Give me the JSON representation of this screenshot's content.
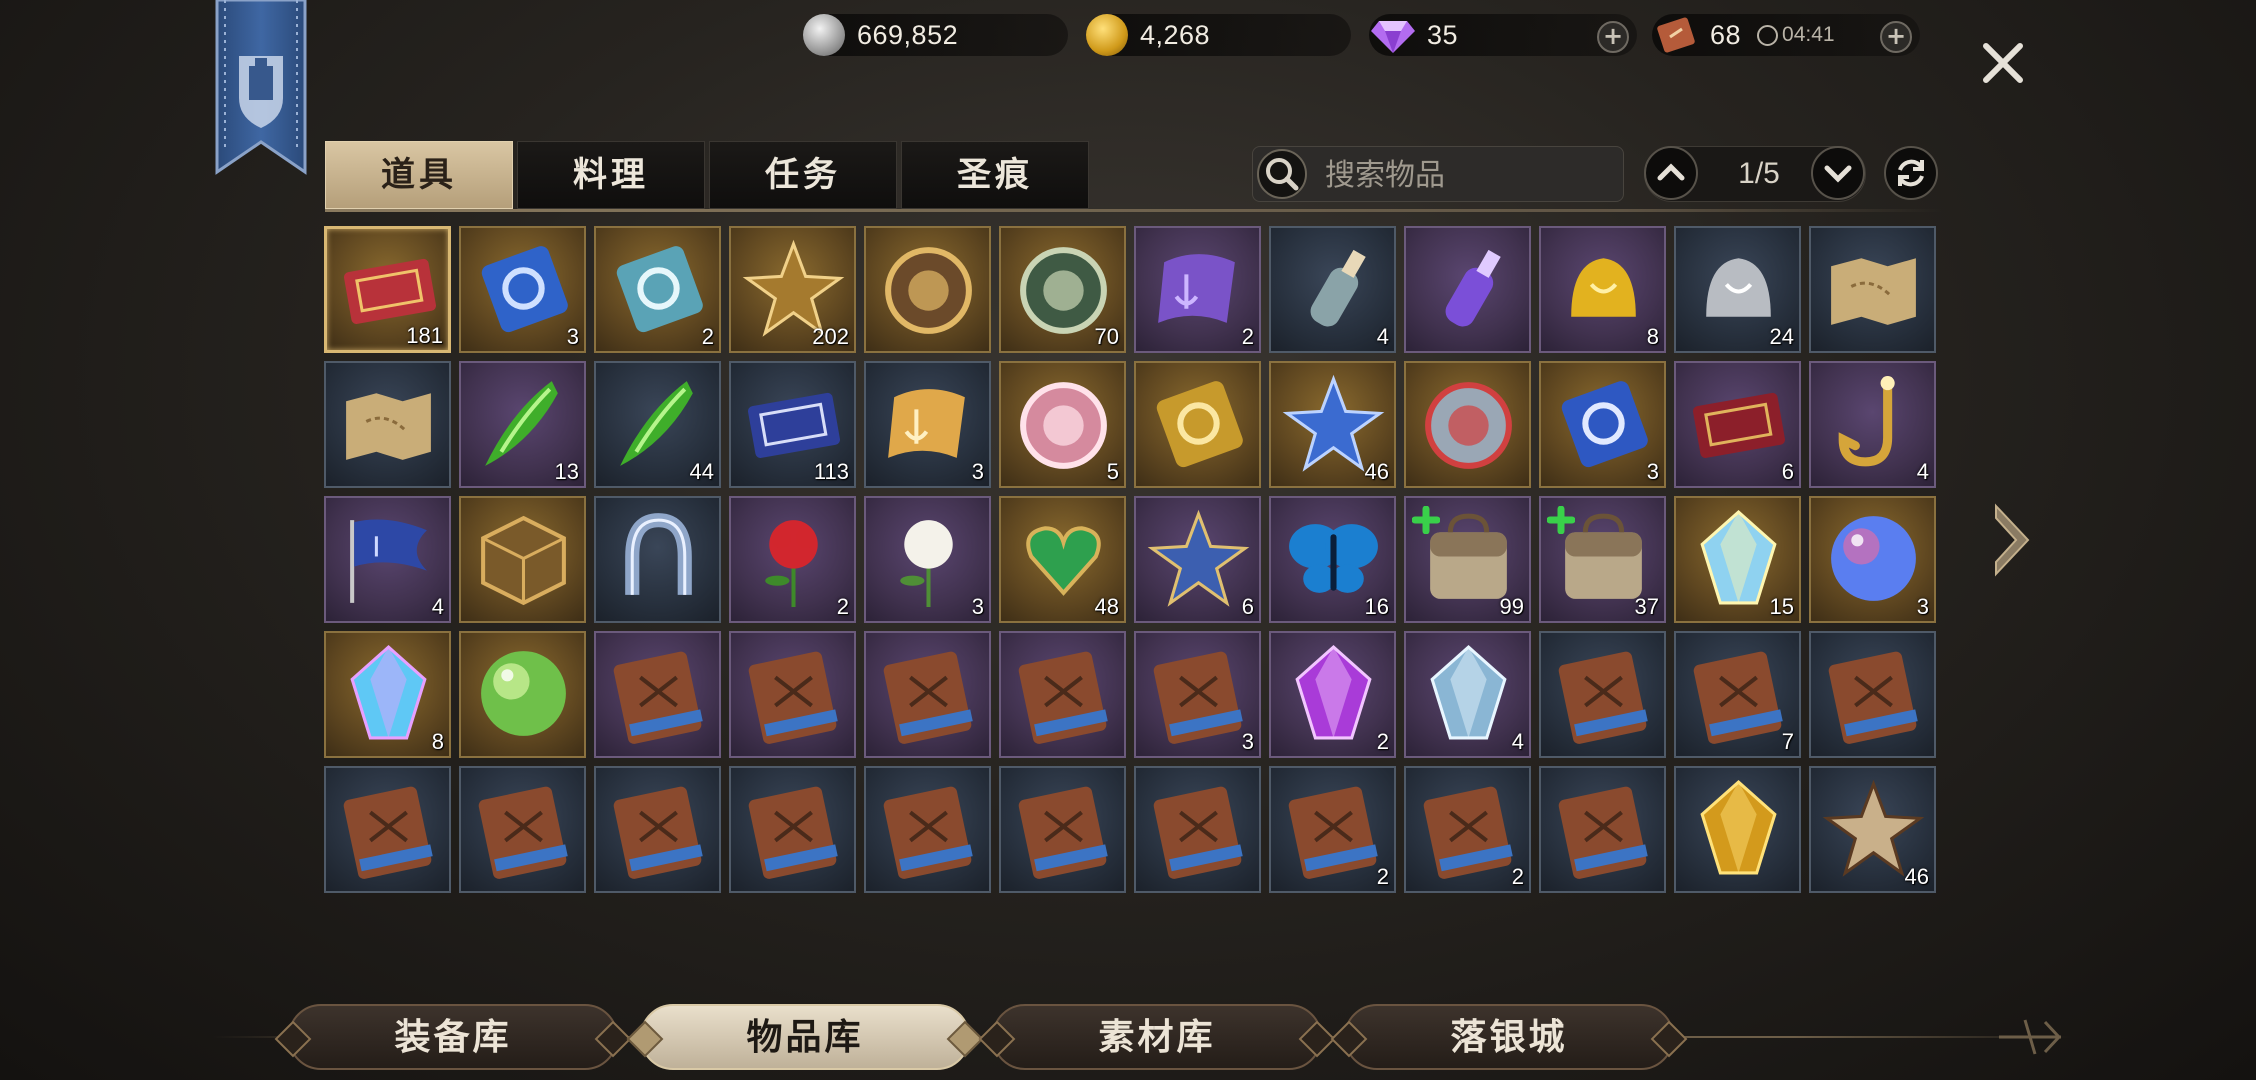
{
  "currencies": [
    {
      "icon": "silver-coin-icon",
      "value": "669,852"
    },
    {
      "icon": "gold-coin-icon",
      "value": "4,268"
    },
    {
      "icon": "diamond-icon",
      "value": "35"
    },
    {
      "icon": "stamina-ticket-icon",
      "value": "68",
      "timer": "04:41"
    }
  ],
  "tabs": [
    {
      "label": "道具",
      "active": true
    },
    {
      "label": "料理",
      "active": false
    },
    {
      "label": "任务",
      "active": false
    },
    {
      "label": "圣痕",
      "active": false
    }
  ],
  "search": {
    "placeholder": "搜索物品"
  },
  "pager": {
    "text": "1/5"
  },
  "items": [
    {
      "icon": "ticket-20-icon",
      "bg": "gold",
      "count": "181",
      "selected": true
    },
    {
      "icon": "blue-card-icon",
      "bg": "gold",
      "count": "3"
    },
    {
      "icon": "crystal-card-icon",
      "bg": "gold",
      "count": "2"
    },
    {
      "icon": "gilded-emblem-icon",
      "bg": "gold",
      "count": "202"
    },
    {
      "icon": "compass-emblem-icon",
      "bg": "gold",
      "count": ""
    },
    {
      "icon": "dragon-coin-icon",
      "bg": "gold",
      "count": "70"
    },
    {
      "icon": "anchor-scroll-icon",
      "bg": "purple",
      "count": "2"
    },
    {
      "icon": "message-bottle-icon",
      "bg": "blue",
      "count": "4"
    },
    {
      "icon": "potion-flask-icon",
      "bg": "purple",
      "count": ""
    },
    {
      "icon": "gold-bell-icon",
      "bg": "purple",
      "count": "8"
    },
    {
      "icon": "silver-bell-icon",
      "bg": "blue",
      "count": "24"
    },
    {
      "icon": "treasure-map-icon",
      "bg": "blue",
      "count": ""
    },
    {
      "icon": "old-map-icon",
      "bg": "blue",
      "count": ""
    },
    {
      "icon": "green-fang-icon",
      "bg": "purple",
      "count": "13"
    },
    {
      "icon": "green-fang-icon",
      "bg": "blue",
      "count": "44"
    },
    {
      "icon": "ticket-10-icon",
      "bg": "blue",
      "count": "113"
    },
    {
      "icon": "talisman-scroll-icon",
      "bg": "blue",
      "count": "3"
    },
    {
      "icon": "paw-coin-icon",
      "bg": "gold",
      "count": "5"
    },
    {
      "icon": "gold-ticket-icon",
      "bg": "gold",
      "count": ""
    },
    {
      "icon": "puzzle-piece-icon",
      "bg": "gold",
      "count": "46"
    },
    {
      "icon": "pickaxe-orb-icon",
      "bg": "gold",
      "count": ""
    },
    {
      "icon": "blue-ticket-icon",
      "bg": "gold",
      "count": "3"
    },
    {
      "icon": "red-ticket-icon",
      "bg": "purple",
      "count": "6"
    },
    {
      "icon": "gold-hook-icon",
      "bg": "purple",
      "count": "4"
    },
    {
      "icon": "blue-flag-icon",
      "bg": "purple",
      "count": "4"
    },
    {
      "icon": "gold-cube-icon",
      "bg": "gold",
      "count": ""
    },
    {
      "icon": "horseshoe-icon",
      "bg": "blue",
      "count": ""
    },
    {
      "icon": "red-rose-icon",
      "bg": "purple",
      "count": "2"
    },
    {
      "icon": "white-lily-icon",
      "bg": "purple",
      "count": "3"
    },
    {
      "icon": "heart-leaf-icon",
      "bg": "gold",
      "count": "48"
    },
    {
      "icon": "cross-medal-icon",
      "bg": "purple",
      "count": "6"
    },
    {
      "icon": "blue-butterfly-icon",
      "bg": "purple",
      "count": "16"
    },
    {
      "icon": "backpack-icon",
      "bg": "purple",
      "count": "99",
      "plus": true
    },
    {
      "icon": "backpack-icon",
      "bg": "purple",
      "count": "37",
      "plus": true
    },
    {
      "icon": "crystal-shard-icon",
      "bg": "gold",
      "count": "15"
    },
    {
      "icon": "rainbow-orb-icon",
      "bg": "gold",
      "count": "3"
    },
    {
      "icon": "prism-crystal-icon",
      "bg": "gold",
      "count": "8"
    },
    {
      "icon": "green-flame-icon",
      "bg": "gold",
      "count": ""
    },
    {
      "icon": "skill-book-icon",
      "bg": "purple",
      "count": ""
    },
    {
      "icon": "skill-book-icon",
      "bg": "purple",
      "count": ""
    },
    {
      "icon": "skill-book-icon",
      "bg": "purple",
      "count": ""
    },
    {
      "icon": "skill-book-icon",
      "bg": "purple",
      "count": ""
    },
    {
      "icon": "skill-book-icon",
      "bg": "purple",
      "count": "3"
    },
    {
      "icon": "purple-gem-icon",
      "bg": "purple",
      "count": "2"
    },
    {
      "icon": "ice-rune-icon",
      "bg": "purple",
      "count": "4"
    },
    {
      "icon": "skill-book-icon",
      "bg": "blue",
      "count": ""
    },
    {
      "icon": "skill-book-icon",
      "bg": "blue",
      "count": "7"
    },
    {
      "icon": "skill-book-icon",
      "bg": "blue",
      "count": ""
    },
    {
      "icon": "skill-book-icon",
      "bg": "blue",
      "count": ""
    },
    {
      "icon": "skill-book-icon",
      "bg": "blue",
      "count": ""
    },
    {
      "icon": "skill-book-icon",
      "bg": "blue",
      "count": ""
    },
    {
      "icon": "skill-book-icon",
      "bg": "blue",
      "count": ""
    },
    {
      "icon": "skill-book-icon",
      "bg": "blue",
      "count": ""
    },
    {
      "icon": "skill-book-icon",
      "bg": "blue",
      "count": ""
    },
    {
      "icon": "skill-book-icon",
      "bg": "blue",
      "count": ""
    },
    {
      "icon": "skill-book-icon",
      "bg": "blue",
      "count": "2"
    },
    {
      "icon": "skill-book-icon",
      "bg": "blue",
      "count": "2"
    },
    {
      "icon": "skill-book-icon",
      "bg": "blue",
      "count": ""
    },
    {
      "icon": "gold-ore-icon",
      "bg": "blue",
      "count": ""
    },
    {
      "icon": "bone-arrow-icon",
      "bg": "blue",
      "count": "46"
    }
  ],
  "bottom_tabs": [
    {
      "label": "装备库",
      "active": false
    },
    {
      "label": "物品库",
      "active": true
    },
    {
      "label": "素材库",
      "active": false
    },
    {
      "label": "落银城",
      "active": false
    }
  ],
  "colors": {
    "accent_gold": "#d9c6a3",
    "slot_gold": "#5e4620",
    "slot_purple": "#41324f",
    "slot_blue": "#27303d"
  }
}
